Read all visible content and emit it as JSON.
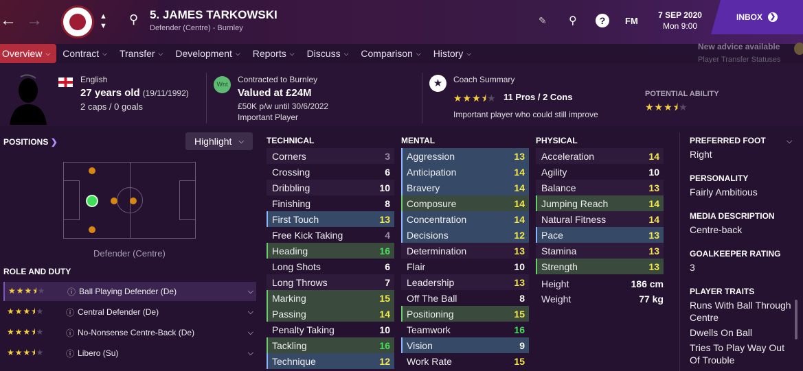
{
  "header": {
    "player_name": "5. JAMES TARKOWSKI",
    "player_sub": "Defender (Centre) - Burnley",
    "date": "7 SEP 2020",
    "day_time": "Mon 9:00",
    "fm_label": "FM",
    "inbox_label": "INBOX"
  },
  "tabs": [
    {
      "label": "Overview"
    },
    {
      "label": "Contract"
    },
    {
      "label": "Transfer"
    },
    {
      "label": "Development"
    },
    {
      "label": "Reports"
    },
    {
      "label": "Discuss"
    },
    {
      "label": "Comparison"
    },
    {
      "label": "History"
    }
  ],
  "advice": {
    "title": "New advice available",
    "sub": "Player Transfer Statuses"
  },
  "summary": {
    "nationality": "English",
    "age": "27 years old",
    "dob": "(19/11/1992)",
    "caps": "2 caps / 0 goals",
    "contract_label": "Contracted to Burnley",
    "value": "Valued at £24M",
    "wage": "£50K p/w until 30/6/2022",
    "status": "Important Player",
    "wnt_badge": "Wnt",
    "coach_label": "Coach Summary",
    "coach_rating": 3.5,
    "pros_cons": "11 Pros / 2 Cons",
    "coach_note": "Important player who could still improve",
    "potential_label": "POTENTIAL ABILITY",
    "potential_rating": 3.5
  },
  "positions": {
    "title": "POSITIONS",
    "highlight_label": "Highlight",
    "position_text": "Defender (Centre)"
  },
  "roles": {
    "title": "ROLE AND DUTY",
    "items": [
      {
        "label": "Ball Playing Defender (De)",
        "stars": 3.5
      },
      {
        "label": "Central Defender (De)",
        "stars": 3.5
      },
      {
        "label": "No-Nonsense Centre-Back (De)",
        "stars": 3.5
      },
      {
        "label": "Libero (Su)",
        "stars": 3.5
      }
    ]
  },
  "technical": {
    "title": "TECHNICAL",
    "rows": [
      {
        "name": "Corners",
        "value": "3",
        "c": "g",
        "h": ""
      },
      {
        "name": "Crossing",
        "value": "6",
        "c": "w",
        "h": ""
      },
      {
        "name": "Dribbling",
        "value": "10",
        "c": "w",
        "h": ""
      },
      {
        "name": "Finishing",
        "value": "8",
        "c": "w",
        "h": ""
      },
      {
        "name": "First Touch",
        "value": "13",
        "c": "y",
        "h": "hlb"
      },
      {
        "name": "Free Kick Taking",
        "value": "4",
        "c": "g",
        "h": ""
      },
      {
        "name": "Heading",
        "value": "16",
        "c": "gr",
        "h": "hlg"
      },
      {
        "name": "Long Shots",
        "value": "6",
        "c": "w",
        "h": ""
      },
      {
        "name": "Long Throws",
        "value": "7",
        "c": "w",
        "h": ""
      },
      {
        "name": "Marking",
        "value": "15",
        "c": "y",
        "h": "hlg"
      },
      {
        "name": "Passing",
        "value": "14",
        "c": "y",
        "h": "hlg"
      },
      {
        "name": "Penalty Taking",
        "value": "10",
        "c": "w",
        "h": ""
      },
      {
        "name": "Tackling",
        "value": "16",
        "c": "gr",
        "h": "hlg"
      },
      {
        "name": "Technique",
        "value": "12",
        "c": "y",
        "h": "hlb"
      }
    ]
  },
  "mental": {
    "title": "MENTAL",
    "rows": [
      {
        "name": "Aggression",
        "value": "13",
        "c": "y",
        "h": "hlb"
      },
      {
        "name": "Anticipation",
        "value": "14",
        "c": "y",
        "h": "hlb"
      },
      {
        "name": "Bravery",
        "value": "14",
        "c": "y",
        "h": "hlb"
      },
      {
        "name": "Composure",
        "value": "14",
        "c": "y",
        "h": "hlg"
      },
      {
        "name": "Concentration",
        "value": "14",
        "c": "y",
        "h": "hlb"
      },
      {
        "name": "Decisions",
        "value": "12",
        "c": "y",
        "h": "hlb"
      },
      {
        "name": "Determination",
        "value": "13",
        "c": "y",
        "h": ""
      },
      {
        "name": "Flair",
        "value": "10",
        "c": "w",
        "h": ""
      },
      {
        "name": "Leadership",
        "value": "13",
        "c": "y",
        "h": ""
      },
      {
        "name": "Off The Ball",
        "value": "8",
        "c": "w",
        "h": ""
      },
      {
        "name": "Positioning",
        "value": "15",
        "c": "y",
        "h": "hlg"
      },
      {
        "name": "Teamwork",
        "value": "16",
        "c": "gr",
        "h": ""
      },
      {
        "name": "Vision",
        "value": "9",
        "c": "w",
        "h": "hlb"
      },
      {
        "name": "Work Rate",
        "value": "15",
        "c": "y",
        "h": ""
      }
    ]
  },
  "physical": {
    "title": "PHYSICAL",
    "rows": [
      {
        "name": "Acceleration",
        "value": "14",
        "c": "y",
        "h": ""
      },
      {
        "name": "Agility",
        "value": "10",
        "c": "w",
        "h": ""
      },
      {
        "name": "Balance",
        "value": "13",
        "c": "y",
        "h": ""
      },
      {
        "name": "Jumping Reach",
        "value": "14",
        "c": "y",
        "h": "hlg"
      },
      {
        "name": "Natural Fitness",
        "value": "14",
        "c": "y",
        "h": ""
      },
      {
        "name": "Pace",
        "value": "13",
        "c": "y",
        "h": "hlb"
      },
      {
        "name": "Stamina",
        "value": "13",
        "c": "y",
        "h": ""
      },
      {
        "name": "Strength",
        "value": "13",
        "c": "y",
        "h": "hlg"
      }
    ],
    "height_label": "Height",
    "height": "186 cm",
    "weight_label": "Weight",
    "weight": "77 kg"
  },
  "sidebar": {
    "foot_label": "PREFERRED FOOT",
    "foot": "Right",
    "personality_label": "PERSONALITY",
    "personality": "Fairly Ambitious",
    "media_label": "MEDIA DESCRIPTION",
    "media": "Centre-back",
    "gk_label": "GOALKEEPER RATING",
    "gk": "3",
    "traits_label": "PLAYER TRAITS",
    "traits": [
      "Runs With Ball Through Centre",
      "Dwells On Ball",
      "Tries To Play Way Out Of Trouble"
    ]
  },
  "colors": {
    "accent": "#b32d3c",
    "inbox": "#5b2aa8",
    "good": "#44e05a",
    "mid": "#f4e84a"
  }
}
